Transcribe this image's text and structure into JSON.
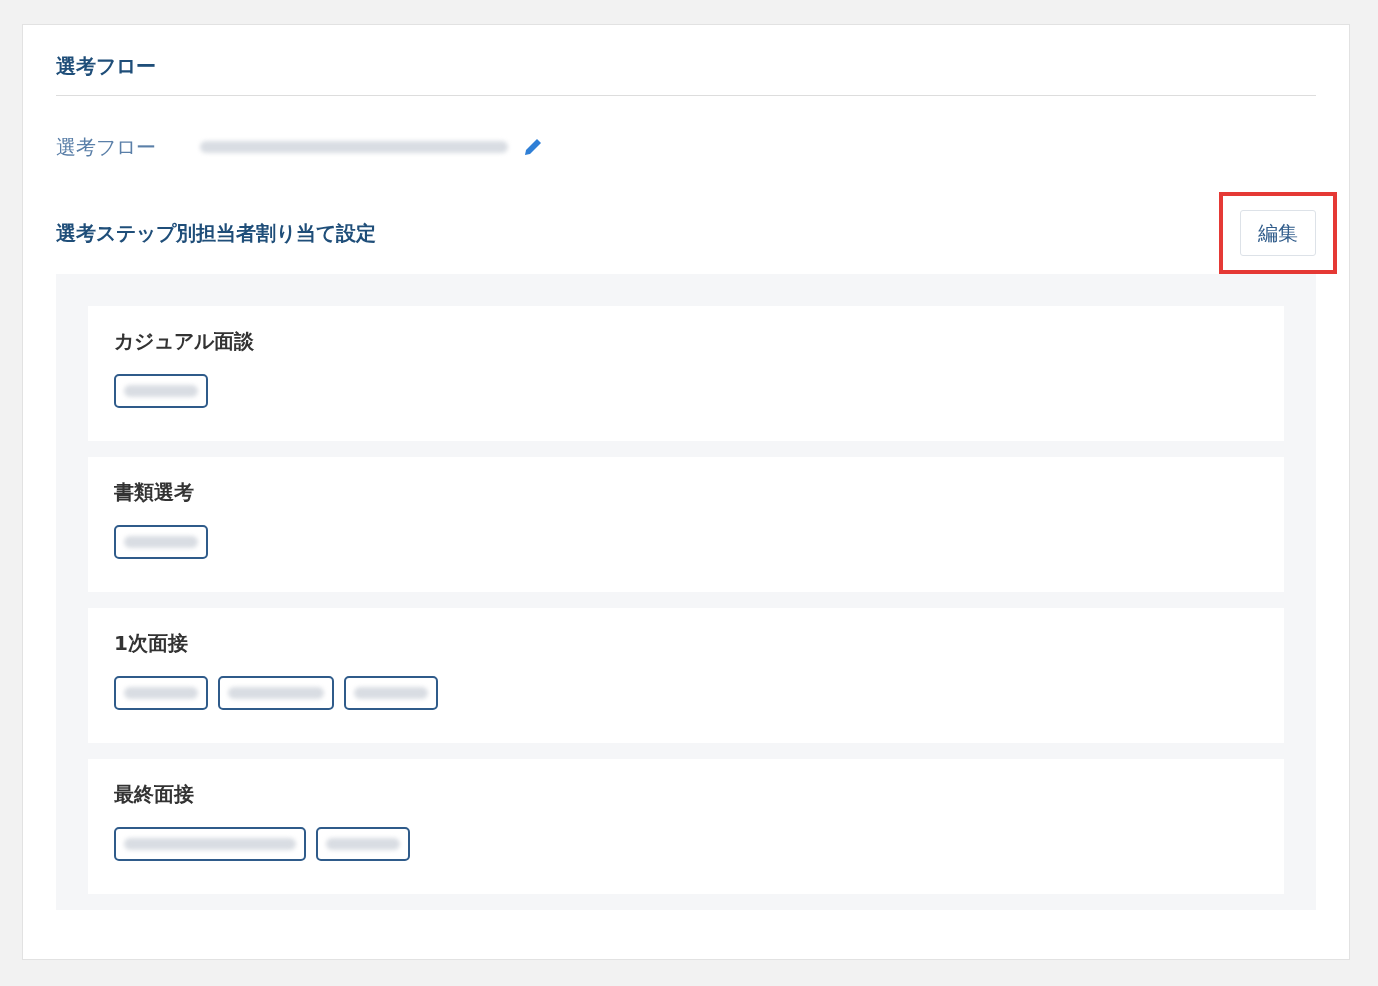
{
  "section": {
    "title": "選考フロー"
  },
  "flow": {
    "label": "選考フロー",
    "value": {
      "kind": "blurred"
    }
  },
  "assignment": {
    "title": "選考ステップ別担当者割り当て設定",
    "edit_button": "編集",
    "highlighted": true
  },
  "steps": [
    {
      "name": "カジュアル面談",
      "assignees": [
        {
          "kind": "short"
        }
      ]
    },
    {
      "name": "書類選考",
      "assignees": [
        {
          "kind": "short"
        }
      ]
    },
    {
      "name": "1次面接",
      "assignees": [
        {
          "kind": "short"
        },
        {
          "kind": "medium"
        },
        {
          "kind": "short"
        }
      ]
    },
    {
      "name": "最終面接",
      "assignees": [
        {
          "kind": "long"
        },
        {
          "kind": "short"
        }
      ]
    }
  ]
}
